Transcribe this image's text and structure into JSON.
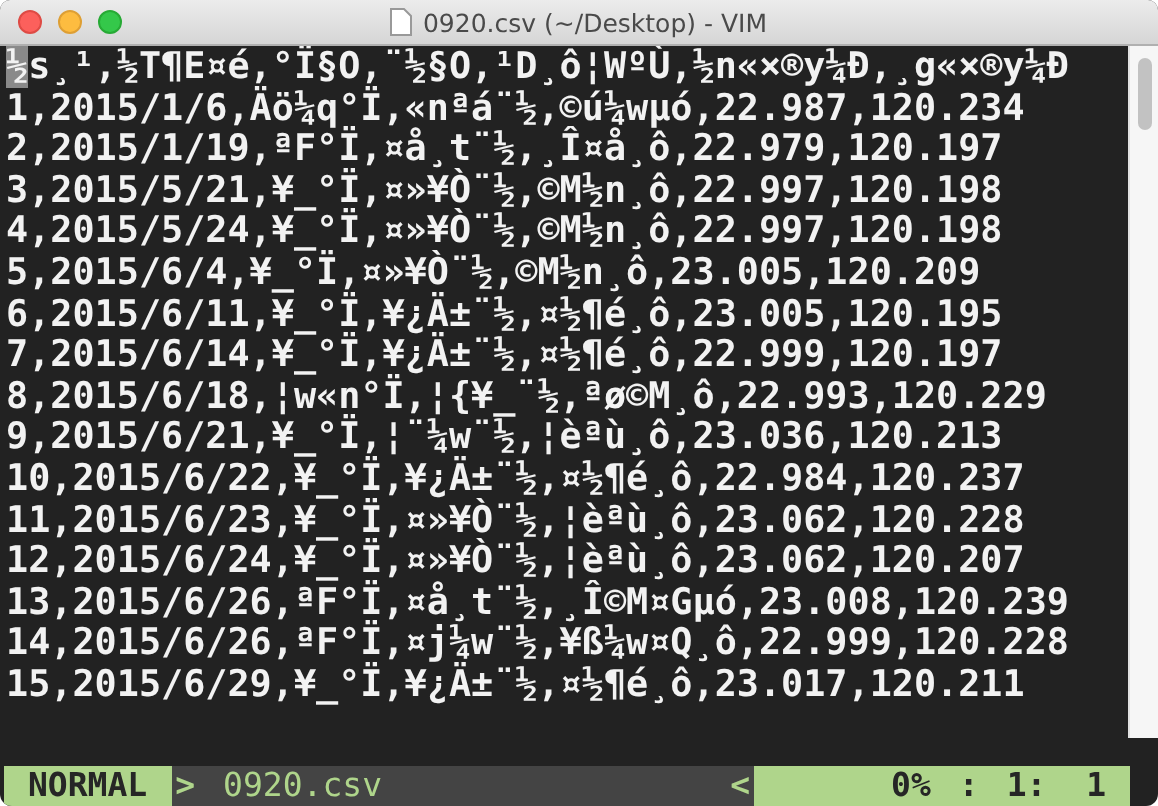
{
  "window": {
    "title": "0920.csv (~/Desktop) - VIM"
  },
  "buffer": {
    "lines": [
      {
        "text": "½s¸¹,½T¶E¤é,°Ï§O,¨½§O,¹D¸ô¦WºÙ,½n«×®y¼Ð,¸g«×®y¼Ð",
        "cursor": true
      },
      {
        "text": "1,2015/1/6,Äö¼q°Ï,«nªá¨½,©ú¼wµó,22.987,120.234",
        "cursor": false
      },
      {
        "text": "2,2015/1/19,ªF°Ï,¤å¸t¨½,¸Î¤å¸ô,22.979,120.197",
        "cursor": false
      },
      {
        "text": "3,2015/5/21,¥_°Ï,¤»¥Ò¨½,©M½n¸ô,22.997,120.198",
        "cursor": false
      },
      {
        "text": "4,2015/5/24,¥_°Ï,¤»¥Ò¨½,©M½n¸ô,22.997,120.198",
        "cursor": false
      },
      {
        "text": "5,2015/6/4,¥_°Ï,¤»¥Ò¨½,©M½n¸ô,23.005,120.209",
        "cursor": false
      },
      {
        "text": "6,2015/6/11,¥_°Ï,¥¿Ä±¨½,¤½¶é¸ô,23.005,120.195",
        "cursor": false
      },
      {
        "text": "7,2015/6/14,¥_°Ï,¥¿Ä±¨½,¤½¶é¸ô,22.999,120.197",
        "cursor": false
      },
      {
        "text": "8,2015/6/18,¦w«n°Ï,¦{¥_¨½,ªø©M¸ô,22.993,120.229",
        "cursor": false
      },
      {
        "text": "9,2015/6/21,¥_°Ï,¦¨¼w¨½,¦èªù¸ô,23.036,120.213",
        "cursor": false
      },
      {
        "text": "10,2015/6/22,¥_°Ï,¥¿Ä±¨½,¤½¶é¸ô,22.984,120.237",
        "cursor": false
      },
      {
        "text": "11,2015/6/23,¥_°Ï,¤»¥Ò¨½,¦èªù¸ô,23.062,120.228",
        "cursor": false
      },
      {
        "text": "12,2015/6/24,¥_°Ï,¤»¥Ò¨½,¦èªù¸ô,23.062,120.207",
        "cursor": false
      },
      {
        "text": "13,2015/6/26,ªF°Ï,¤å¸t¨½,¸Î©M¤Gµó,23.008,120.239",
        "cursor": false
      },
      {
        "text": "14,2015/6/26,ªF°Ï,¤j¼w¨½,¥ß¼w¤Q¸ô,22.999,120.228",
        "cursor": false
      },
      {
        "text": "15,2015/6/29,¥_°Ï,¥¿Ä±¨½,¤½¶é¸ô,23.017,120.211",
        "cursor": false
      }
    ]
  },
  "status_line": {
    "mode": "NORMAL",
    "separator_left": ">",
    "file": "0920.csv",
    "separator_right": "<",
    "percent": "0%",
    "divider": ":",
    "position": "1:  1"
  }
}
